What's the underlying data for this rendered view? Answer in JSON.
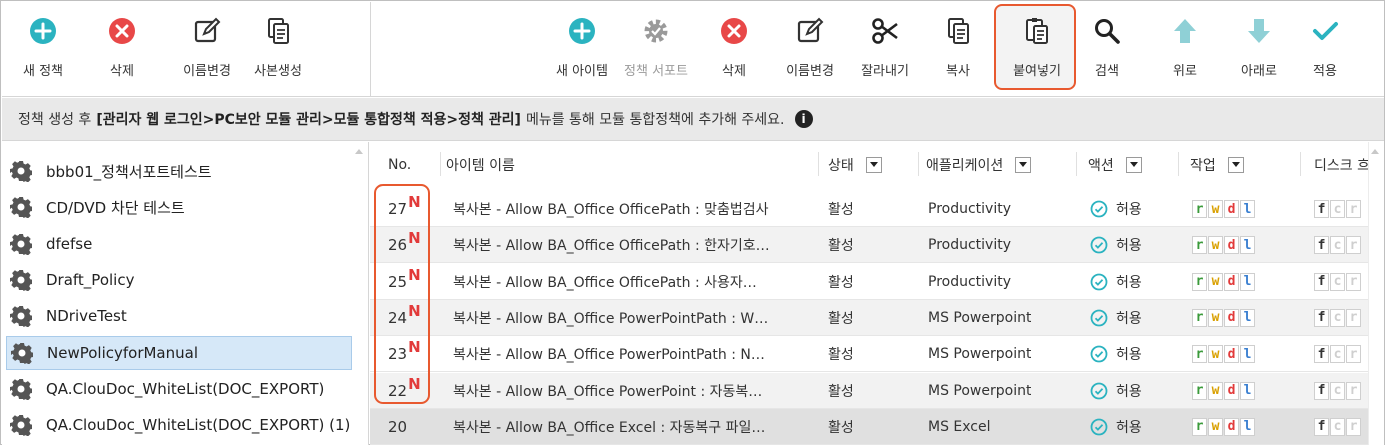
{
  "toolbar_left": [
    {
      "label": "새 정책",
      "icon": "plus-circle-icon"
    },
    {
      "label": "삭제",
      "icon": "x-circle-icon"
    },
    {
      "label": "이름변경",
      "icon": "edit-icon"
    },
    {
      "label": "사본생성",
      "icon": "copy-icon"
    }
  ],
  "toolbar_right": [
    {
      "label": "새 아이템",
      "icon": "plus-circle-icon"
    },
    {
      "label": "정책 서포트",
      "icon": "gear-check-icon"
    },
    {
      "label": "삭제",
      "icon": "x-circle-icon"
    },
    {
      "label": "이름변경",
      "icon": "edit-icon"
    },
    {
      "label": "잘라내기",
      "icon": "scissors-icon"
    },
    {
      "label": "복사",
      "icon": "copy-icon"
    },
    {
      "label": "붙여넣기",
      "icon": "paste-icon"
    },
    {
      "label": "검색",
      "icon": "search-icon"
    },
    {
      "label": "위로",
      "icon": "arrow-up-icon"
    },
    {
      "label": "아래로",
      "icon": "arrow-down-icon"
    },
    {
      "label": "적용",
      "icon": "check-icon"
    }
  ],
  "info": {
    "prefix": "정책 생성 후",
    "path": "[관리자 웹 로그인>PC보안 모듈 관리>모듈 통합정책 적용>정책 관리]",
    "suffix": "메뉴를 통해 모듈 통합정책에 추가해 주세요.",
    "icon_text": "i"
  },
  "policies": [
    "bbb01_정책서포트테스트",
    "CD/DVD 차단 테스트",
    "dfefse",
    "Draft_Policy",
    "NDriveTest",
    "NewPolicyforManual",
    "QA.ClouDoc_WhiteList(DOC_EXPORT)",
    "QA.ClouDoc_WhiteList(DOC_EXPORT) (1)"
  ],
  "columns": {
    "no": "No.",
    "name": "아이템 이름",
    "status": "상태",
    "app": "애플리케이션",
    "action": "액션",
    "work": "작업",
    "disk": "디스크 흐"
  },
  "items": [
    {
      "no": "27",
      "new": "N",
      "name": "복사본 - Allow BA_Office OfficePath : 맞춤법검사",
      "status": "활성",
      "app": "Productivity",
      "action": "허용"
    },
    {
      "no": "26",
      "new": "N",
      "name": "복사본 - Allow BA_Office OfficePath : 한자기호…",
      "status": "활성",
      "app": "Productivity",
      "action": "허용"
    },
    {
      "no": "25",
      "new": "N",
      "name": "복사본 - Allow BA_Office OfficePath : 사용자…",
      "status": "활성",
      "app": "Productivity",
      "action": "허용"
    },
    {
      "no": "24",
      "new": "N",
      "name": "복사본 - Allow BA_Office PowerPointPath : W…",
      "status": "활성",
      "app": "MS Powerpoint",
      "action": "허용"
    },
    {
      "no": "23",
      "new": "N",
      "name": "복사본 - Allow BA_Office PowerPointPath : N…",
      "status": "활성",
      "app": "MS Powerpoint",
      "action": "허용"
    },
    {
      "no": "22",
      "new": "N",
      "name": "복사본 - Allow BA_Office PowerPoint : 자동복…",
      "status": "활성",
      "app": "MS Powerpoint",
      "action": "허용"
    },
    {
      "no": "20",
      "new": "",
      "name": "복사본 - Allow BA_Office Excel : 자동복구 파일…",
      "status": "활성",
      "app": "MS Excel",
      "action": "허용"
    }
  ],
  "perm_letters": [
    "r",
    "w",
    "d",
    "l"
  ],
  "disk_letters": [
    "f",
    "c",
    "r"
  ],
  "colors": {
    "accent_teal": "#2bb3c0",
    "delete_red": "#e84848",
    "highlight_orange": "#e8592f",
    "new_red": "#e23a3a"
  }
}
